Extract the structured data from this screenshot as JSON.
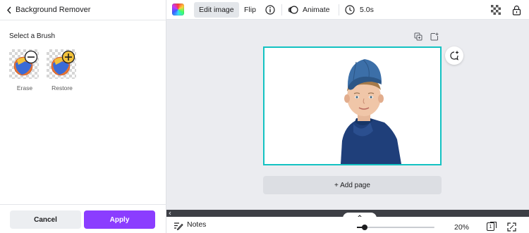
{
  "panel": {
    "title": "Background Remover",
    "section_label": "Select a Brush",
    "brushes": [
      {
        "label": "Erase",
        "icon": "minus-circle-icon"
      },
      {
        "label": "Restore",
        "icon": "plus-circle-icon"
      }
    ],
    "cancel_label": "Cancel",
    "apply_label": "Apply"
  },
  "toolbar": {
    "edit_image_label": "Edit image",
    "flip_label": "Flip",
    "animate_label": "Animate",
    "duration": "5.0s"
  },
  "canvas": {
    "add_page_label": "+ Add page"
  },
  "bottom": {
    "notes_label": "Notes",
    "zoom": "20%",
    "zoom_fraction": 0.1,
    "page_count": "1"
  },
  "colors": {
    "accent": "#8b3dff",
    "selection": "#13c2c2",
    "canvas_bg": "#ebecf0",
    "scroll_strip": "#3d3f45"
  }
}
